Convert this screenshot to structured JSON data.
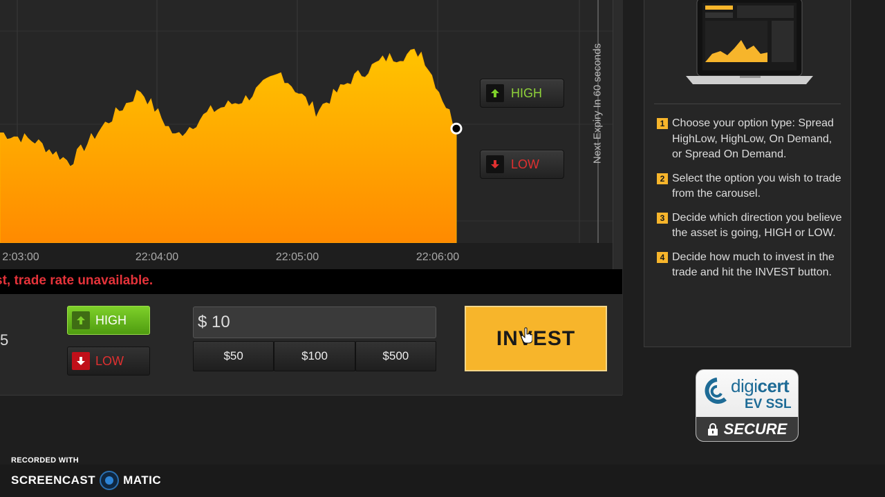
{
  "chart": {
    "x_tick_labels": [
      "2:03:00",
      "22:04:00",
      "22:05:00",
      "22:06:00"
    ],
    "expiry_label": "Next Expiry In 60 seconds",
    "fill_color_top": "#ffc400",
    "fill_color_bottom": "#ff8a00",
    "high_button": "HIGH",
    "low_button": "LOW"
  },
  "chart_data": {
    "type": "area",
    "x": [
      "22:02:55",
      "22:03:10",
      "22:03:25",
      "22:03:40",
      "22:03:55",
      "22:04:10",
      "22:04:25",
      "22:04:40",
      "22:04:55",
      "22:05:10",
      "22:05:25",
      "22:05:40",
      "22:05:55",
      "22:06:05"
    ],
    "values": [
      0.52,
      0.48,
      0.38,
      0.56,
      0.72,
      0.5,
      0.62,
      0.68,
      0.8,
      0.62,
      0.77,
      0.87,
      0.9,
      0.54
    ],
    "xlabel": "",
    "ylabel": ""
  },
  "status_message": "st, trade rate unavailable.",
  "trade": {
    "partial_value": "5",
    "high_label": "HIGH",
    "low_label": "LOW",
    "amount_value": "$ 10",
    "presets": [
      "$50",
      "$100",
      "$500"
    ],
    "invest_label": "INVEST"
  },
  "instructions": {
    "steps": [
      {
        "num": "1",
        "text": "Choose your option type: Spread HighLow, HighLow, On Demand, or Spread On Demand."
      },
      {
        "num": "2",
        "text": "Select the option you wish to trade from the carousel."
      },
      {
        "num": "3",
        "text": "Decide which direction you believe the asset is going, HIGH or LOW."
      },
      {
        "num": "4",
        "text": "Decide how much to invest in the trade and hit the INVEST button."
      }
    ]
  },
  "ssl_badge": {
    "brand_a": "digi",
    "brand_b": "cert",
    "ev": "EV SSL",
    "secure": "SECURE"
  },
  "recorder": {
    "small": "RECORDED WITH",
    "left": "SCREENCAST",
    "right": "MATIC"
  },
  "colors": {
    "accent": "#f7b52b",
    "high_green": "#7ed02a",
    "low_red": "#e03030",
    "warning_red": "#e4333a"
  }
}
